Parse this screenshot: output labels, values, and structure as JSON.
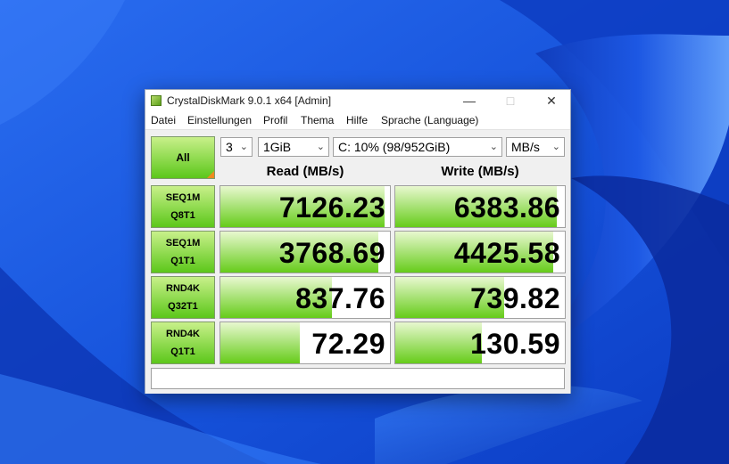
{
  "window": {
    "title": "CrystalDiskMark 9.0.1 x64 [Admin]"
  },
  "menu": [
    "Datei",
    "Einstellungen",
    "Profil",
    "Thema",
    "Hilfe",
    "Sprache (Language)"
  ],
  "controls": {
    "all_label": "All",
    "count": "3",
    "size": "1GiB",
    "drive": "C: 10% (98/952GiB)",
    "unit": "MB/s"
  },
  "headers": {
    "read": "Read (MB/s)",
    "write": "Write (MB/s)"
  },
  "rows": [
    {
      "line1": "SEQ1M",
      "line2": "Q8T1",
      "read": "7126.23",
      "write": "6383.86",
      "read_fill": 0.97,
      "write_fill": 0.95
    },
    {
      "line1": "SEQ1M",
      "line2": "Q1T1",
      "read": "3768.69",
      "write": "4425.58",
      "read_fill": 0.93,
      "write_fill": 0.93
    },
    {
      "line1": "RND4K",
      "line2": "Q32T1",
      "read": "837.76",
      "write": "739.82",
      "read_fill": 0.66,
      "write_fill": 0.64
    },
    {
      "line1": "RND4K",
      "line2": "Q1T1",
      "read": "72.29",
      "write": "130.59",
      "read_fill": 0.47,
      "write_fill": 0.51
    }
  ],
  "comment": "",
  "colors": {
    "accent_green": "#66cc1a",
    "corner_orange": "#f08a1e",
    "desktop_blue": "#1f62e6"
  }
}
